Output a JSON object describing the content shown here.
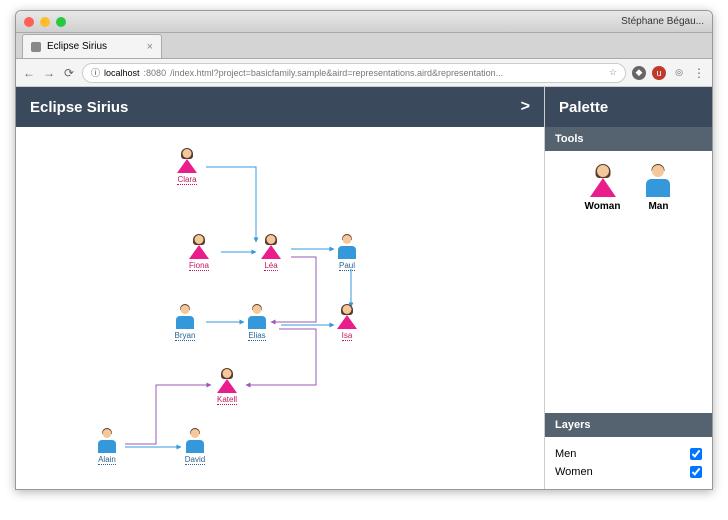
{
  "browser": {
    "profile": "Stéphane Bégau...",
    "tab_title": "Eclipse Sirius",
    "url_prefix": "ⓘ",
    "url_host": "localhost",
    "url_port": ":8080",
    "url_path": "/index.html?project=basicfamily.sample&aird=representations.aird&representation..."
  },
  "header": {
    "title": "Eclipse Sirius",
    "expand": ">"
  },
  "nodes": {
    "clara": {
      "label": "Clara",
      "gender": "f"
    },
    "fiona": {
      "label": "Fiona",
      "gender": "f"
    },
    "lea": {
      "label": "Léa",
      "gender": "f"
    },
    "paul": {
      "label": "Paul",
      "gender": "m"
    },
    "bryan": {
      "label": "Bryan",
      "gender": "m"
    },
    "elias": {
      "label": "Elias",
      "gender": "m"
    },
    "isa": {
      "label": "Isa",
      "gender": "f"
    },
    "katell": {
      "label": "Katell",
      "gender": "f"
    },
    "alain": {
      "label": "Alain",
      "gender": "m"
    },
    "david": {
      "label": "David",
      "gender": "m"
    }
  },
  "palette": {
    "title": "Palette",
    "tools_label": "Tools",
    "woman_label": "Woman",
    "man_label": "Man",
    "layers_label": "Layers",
    "layer_men": "Men",
    "layer_women": "Women"
  }
}
